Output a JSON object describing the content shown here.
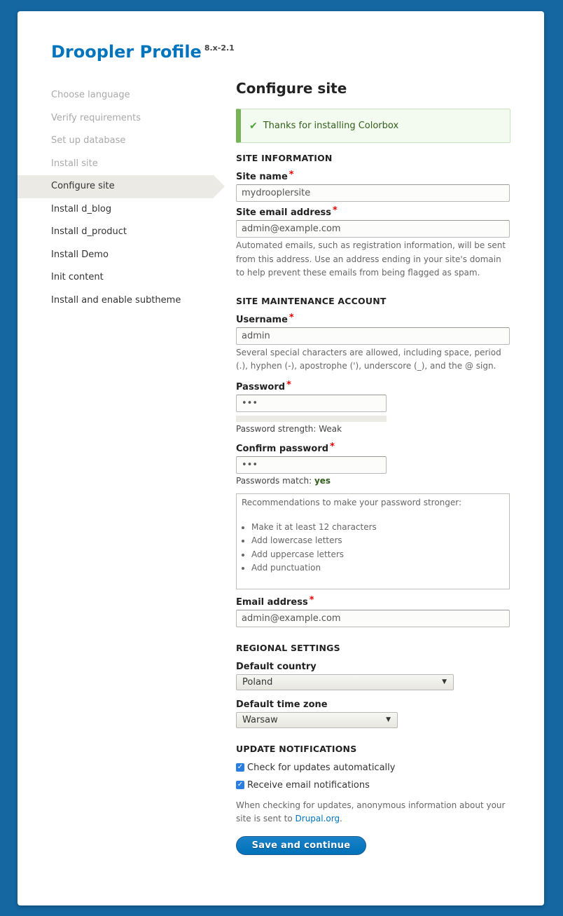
{
  "header": {
    "title": "Droopler Profile",
    "version": "8.x-2.1"
  },
  "steps": [
    {
      "label": "Choose language",
      "state": "done"
    },
    {
      "label": "Verify requirements",
      "state": "done"
    },
    {
      "label": "Set up database",
      "state": "done"
    },
    {
      "label": "Install site",
      "state": "done"
    },
    {
      "label": "Configure site",
      "state": "active"
    },
    {
      "label": "Install d_blog",
      "state": "pending"
    },
    {
      "label": "Install d_product",
      "state": "pending"
    },
    {
      "label": "Install Demo",
      "state": "pending"
    },
    {
      "label": "Init content",
      "state": "pending"
    },
    {
      "label": "Install and enable subtheme",
      "state": "pending"
    }
  ],
  "main": {
    "title": "Configure site",
    "message": {
      "icon": "check-icon",
      "text": "Thanks for installing Colorbox"
    },
    "site_information": {
      "title": "SITE INFORMATION",
      "site_name": {
        "label": "Site name",
        "required": "*",
        "value": "mydrooplersite"
      },
      "site_email": {
        "label": "Site email address",
        "required": "*",
        "value": "admin@example.com",
        "description": "Automated emails, such as registration information, will be sent from this address. Use an address ending in your site's domain to help prevent these emails from being flagged as spam."
      }
    },
    "maintenance_account": {
      "title": "SITE MAINTENANCE ACCOUNT",
      "username": {
        "label": "Username",
        "required": "*",
        "value": "admin",
        "description": "Several special characters are allowed, including space, period (.), hyphen (-), apostrophe ('), underscore (_), and the @ sign."
      },
      "password": {
        "label": "Password",
        "required": "*",
        "value": "•••",
        "strength_text": "Password strength: Weak",
        "strength_percent": 0
      },
      "confirm_password": {
        "label": "Confirm password",
        "required": "*",
        "value": "•••",
        "match_label": "Passwords match:",
        "match_value": "yes"
      },
      "suggestions": {
        "title": "Recommendations to make your password stronger:",
        "items": [
          "Make it at least 12 characters",
          "Add lowercase letters",
          "Add uppercase letters",
          "Add punctuation"
        ]
      },
      "email": {
        "label": "Email address",
        "required": "*",
        "value": "admin@example.com"
      }
    },
    "regional": {
      "title": "REGIONAL SETTINGS",
      "country": {
        "label": "Default country",
        "value": "Poland"
      },
      "timezone": {
        "label": "Default time zone",
        "value": "Warsaw"
      }
    },
    "updates": {
      "title": "UPDATE NOTIFICATIONS",
      "check_updates": {
        "label": "Check for updates automatically",
        "checked": true
      },
      "email_notifications": {
        "label": "Receive email notifications",
        "checked": true
      },
      "description_prefix": "When checking for updates, anonymous information about your site is sent to ",
      "description_link": "Drupal.org",
      "description_suffix": "."
    },
    "submit_label": "Save and continue"
  }
}
